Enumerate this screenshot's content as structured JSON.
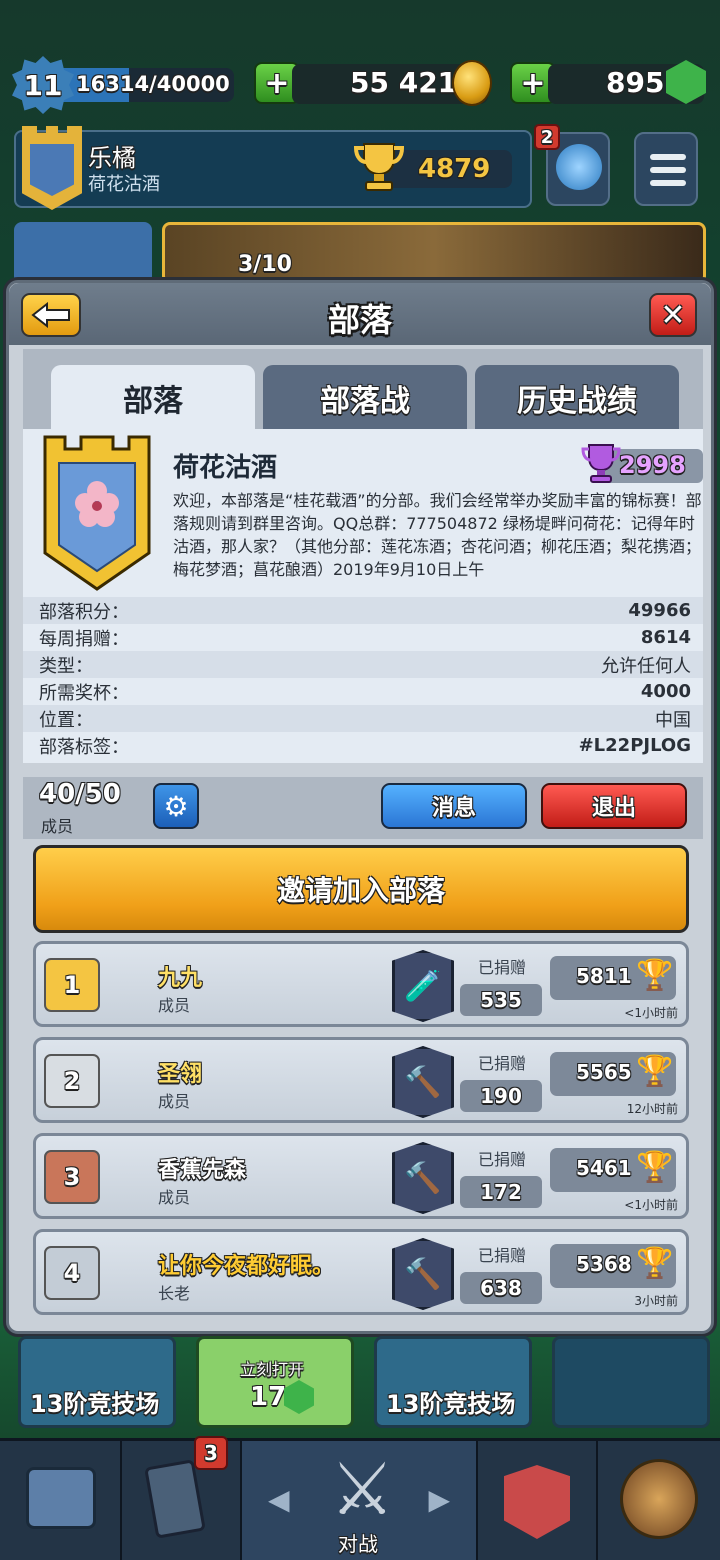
{
  "status": {
    "level": "11",
    "xp": "16314/40000",
    "xp_progress": 0.41,
    "gold": "55 421",
    "gems": "895"
  },
  "profile": {
    "name": "乐橘",
    "clan": "荷花沽酒",
    "trophies": "4879",
    "notification_count": "2"
  },
  "behind": {
    "event_progress": "3/10"
  },
  "panel": {
    "title": "部落",
    "tabs": [
      {
        "label": "部落",
        "active": true
      },
      {
        "label": "部落战",
        "active": false
      },
      {
        "label": "历史战绩",
        "active": false
      }
    ],
    "clan": {
      "name": "荷花沽酒",
      "trophies": "2998",
      "description": "欢迎，本部落是“桂花载酒”的分部。我们会经常举办奖励丰富的锦标赛！部落规则请到群里咨询。QQ总群：777504872 绿杨堤畔问荷花：记得年时沽酒，那人家？（其他分部：莲花冻酒；杏花问酒；柳花压酒；梨花携酒；梅花梦酒；菖花酿酒）2019年9月10日上午"
    },
    "stats": [
      {
        "label": "部落积分：",
        "value": "49966"
      },
      {
        "label": "每周捐赠：",
        "value": "8614"
      },
      {
        "label": "类型：",
        "value": "允许任何人"
      },
      {
        "label": "所需奖杯：",
        "value": "4000"
      },
      {
        "label": "位置：",
        "value": "中国"
      },
      {
        "label": "部落标签：",
        "value": "#L22PJLOG"
      }
    ],
    "members": {
      "count": "40/50",
      "label": "成员",
      "message_button": "消息",
      "leave_button": "退出",
      "invite_button": "邀请加入部落"
    },
    "member_list": [
      {
        "rank": "1",
        "name": "九九",
        "role": "成员",
        "donated_label": "已捐赠",
        "donated": "535",
        "trophies": "5811",
        "last_seen": "<1小时前",
        "name_color": "#ffe066",
        "rank_color": "#f4c542",
        "card": "potion-card-icon"
      },
      {
        "rank": "2",
        "name": "圣翎",
        "role": "成员",
        "donated_label": "已捐赠",
        "donated": "190",
        "trophies": "5565",
        "last_seen": "12小时前",
        "name_color": "#ffe066",
        "rank_color": "#d8dde2",
        "card": "hammer-card-icon"
      },
      {
        "rank": "3",
        "name": "香蕉先森",
        "role": "成员",
        "donated_label": "已捐赠",
        "donated": "172",
        "trophies": "5461",
        "last_seen": "<1小时前",
        "name_color": "#ffffff",
        "rank_color": "#c9765a",
        "card": "hammer-card-icon"
      },
      {
        "rank": "4",
        "name": "让你今夜都好眠。",
        "role": "长老",
        "donated_label": "已捐赠",
        "donated": "638",
        "trophies": "5368",
        "last_seen": "3小时前",
        "name_color": "#ffcc33",
        "rank_color": "#c3ccd6",
        "card": "hammer-card-icon"
      }
    ]
  },
  "bottom": {
    "arena_left": "13阶竞技场",
    "open_now": "立刻打开",
    "open_cost": "17",
    "arena_right": "13阶竞技场",
    "cards_badge": "3",
    "battle_label": "对战"
  }
}
